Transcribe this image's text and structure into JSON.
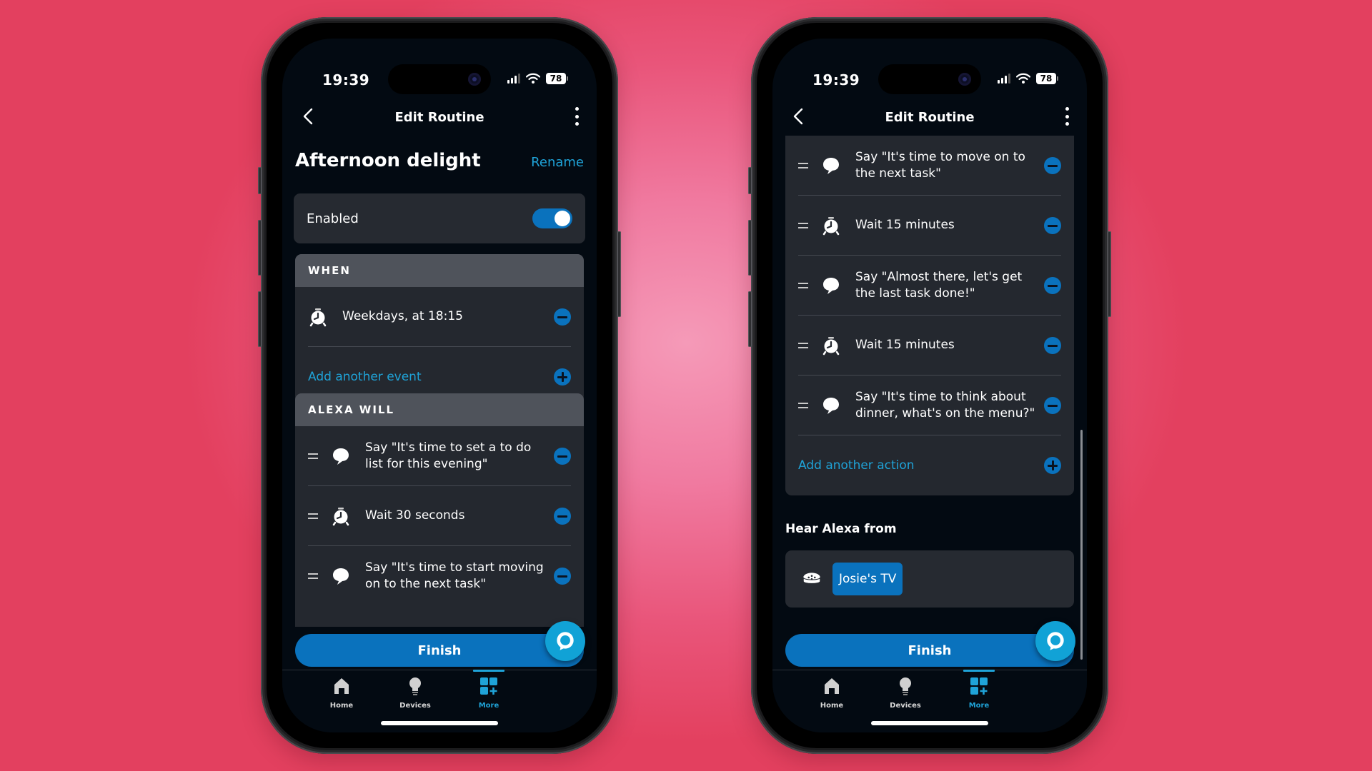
{
  "status_bar": {
    "time": "19:39",
    "battery": "78"
  },
  "app_bar": {
    "title": "Edit Routine",
    "back_icon": "chevron-left-icon",
    "menu_icon": "kebab-icon"
  },
  "colors": {
    "accent": "#0A72BD",
    "link": "#1FA3D8",
    "background": "#030A12",
    "card": "#24282F",
    "card_header": "#4F535B",
    "alexa_blue": "#11A2D6"
  },
  "left_screen": {
    "routine_name": "Afternoon delight",
    "rename_label": "Rename",
    "enabled_label": "Enabled",
    "enabled": true,
    "when": {
      "header": "WHEN",
      "events": [
        {
          "icon": "alarm-clock-icon",
          "text": "Weekdays, at 18:15"
        }
      ],
      "add_label": "Add another event"
    },
    "alexa_will": {
      "header": "ALEXA WILL",
      "actions": [
        {
          "icon": "speech-bubble-icon",
          "text": "Say \"It's time to set a to do list for this evening\""
        },
        {
          "icon": "alarm-clock-icon",
          "text": "Wait 30 seconds"
        },
        {
          "icon": "speech-bubble-icon",
          "text": "Say \"It's time to start moving on to the next task\""
        }
      ]
    },
    "finish_label": "Finish"
  },
  "right_screen": {
    "actions": [
      {
        "icon": "speech-bubble-icon",
        "text": "Say \"It's time to move on to the next task\""
      },
      {
        "icon": "alarm-clock-icon",
        "text": "Wait 15 minutes"
      },
      {
        "icon": "speech-bubble-icon",
        "text": "Say \"Almost there, let's get the last task done!\""
      },
      {
        "icon": "alarm-clock-icon",
        "text": "Wait 15 minutes"
      },
      {
        "icon": "speech-bubble-icon",
        "text": "Say \"It's time to think about dinner, what's on the menu?\""
      }
    ],
    "add_label": "Add another action",
    "hear_from_title": "Hear Alexa from",
    "device": {
      "icon": "echo-dot-icon",
      "name": "Josie's TV"
    },
    "finish_label": "Finish"
  },
  "tabs": [
    {
      "label": "Home",
      "icon": "home-icon",
      "active": false
    },
    {
      "label": "Devices",
      "icon": "lightbulb-icon",
      "active": false
    },
    {
      "label": "More",
      "icon": "grid-plus-icon",
      "active": true
    }
  ]
}
